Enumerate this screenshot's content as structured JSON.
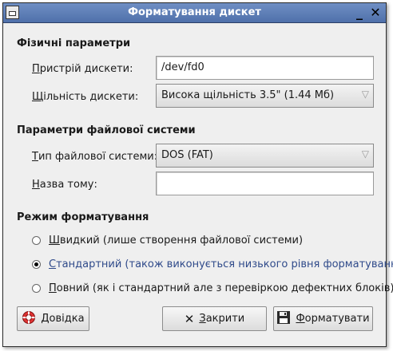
{
  "window": {
    "title": "Форматування дискет"
  },
  "physical": {
    "section_title": "Фізичні параметри",
    "device_label_u": "П",
    "device_label_rest": "ристрій дискети:",
    "device_value": "/dev/fd0",
    "density_label_u": "Щ",
    "density_label_rest": "ільність дискети:",
    "density_value": "Висока щільність 3.5\" (1.44 Мб)"
  },
  "filesystem": {
    "section_title": "Параметри файлової системи",
    "type_label_u": "Т",
    "type_label_rest": "ип файлової системи:",
    "type_value": "DOS (FAT)",
    "volume_label_u": "Н",
    "volume_label_rest": "азва тому:",
    "volume_value": ""
  },
  "mode": {
    "section_title": "Режим форматування",
    "options": [
      {
        "u": "Ш",
        "rest": "видкий (лише створення файлової системи)",
        "checked": false
      },
      {
        "u": "С",
        "rest": "тандартний (також виконується низького рівня форматування)",
        "checked": true
      },
      {
        "u": "П",
        "rest": "овний (як і стандартний але з перевіркою дефектних блоків)",
        "checked": false
      }
    ]
  },
  "buttons": {
    "help_u": "Д",
    "help_rest": "овідка",
    "close_u": "З",
    "close_rest": "акрити",
    "format_u": "Ф",
    "format_rest": "орматувати"
  },
  "icons": [
    "window-menu-icon",
    "minimize-icon",
    "close-window-icon",
    "dropdown-arrow-icon",
    "help-lifebuoy-icon",
    "close-x-icon",
    "floppy-disk-icon"
  ]
}
